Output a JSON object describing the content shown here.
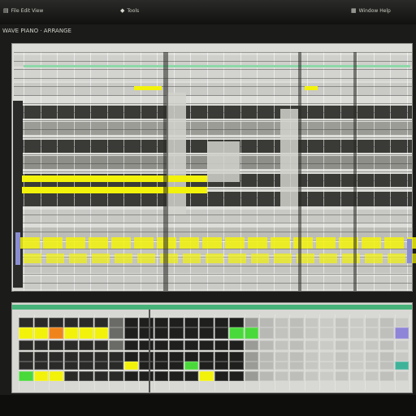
{
  "window": {
    "menus": [
      {
        "glyph": "▤",
        "label": "File Edit View"
      },
      {
        "glyph": "◆",
        "label": "Tools"
      },
      {
        "glyph": "▦",
        "label": "Window Help"
      }
    ],
    "caption": "WAVE PIANO · ARRANGE"
  },
  "colors": {
    "background": "#1b1c1a",
    "grid_light": "#d6d6d2",
    "cell_dark": "#2f302c",
    "cell_mid": "#8e8e88",
    "clip_yellow": "#f2f20a",
    "clip_green": "#49d93a",
    "clip_orange": "#f0841a",
    "clip_teal": "#3fb39a",
    "clip_violet": "#8e84d8"
  }
}
